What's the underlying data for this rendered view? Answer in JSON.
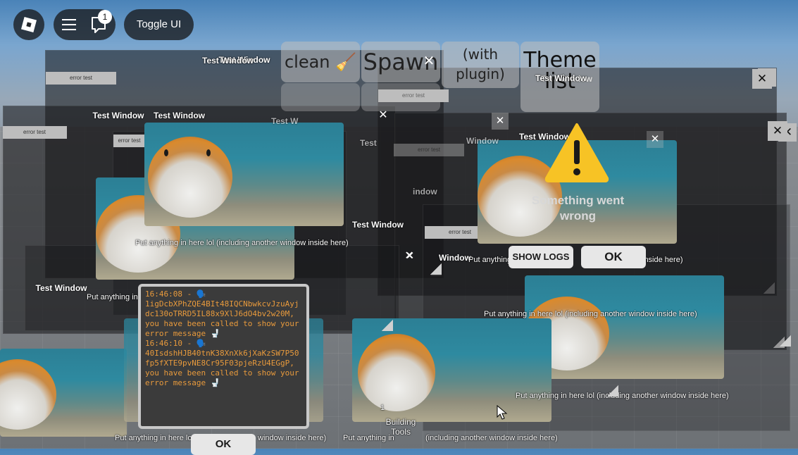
{
  "topbar": {
    "notification_count": "1",
    "toggle_label": "Toggle UI"
  },
  "toolbar": {
    "clean_label": "clean 🧹",
    "spawn_label": "Spawn",
    "plugin_label": "(with plugin)",
    "theme_label": "Theme list",
    "close_glyph": "✕"
  },
  "windows": {
    "title": "Test Window",
    "tab_label": "error test",
    "close_glyph": "✕",
    "caption": "Put anything in here lol (including another window inside here)",
    "caption_partial_1": "Put anything in here lo",
    "caption_partial_2": "window inside here)",
    "caption_partial_3": "Put anything in here lol",
    "caption_partial_4": "(including another window inside here)",
    "caption_partial_5": "Put anything in",
    "caption_partial_6": "inside here)",
    "title_partial_1": "Test Window",
    "title_partial_2": "Test",
    "title_partial_3": "indow",
    "title_partial_4": "Test Window",
    "title_partial_5": "Window",
    "title_partial_6": "Test W",
    "title_partial_7": "Test Window"
  },
  "error_dialog": {
    "message": "Something went wrong",
    "show_logs_label": "SHOW LOGS",
    "ok_label": "OK"
  },
  "log_panel": {
    "text": "16:46:08 - 🗣️\n1igDcbXPhZQE4BIt48IQCNbwkcvJzuAyjdc130oTRRD5IL88x9XlJ6dO4bv2w20M, you have been called to show your error message 🚽\n16:46:10 - 🗣️\n40IsdshHJB40tnK38XnXk6jXaKzSW7P50fp5fXTE9pvNE8Cr95F03pjeRzU4EGgP, you have been called to show your error message 🚽",
    "ok_label": "OK"
  },
  "building_tools": {
    "count": "1",
    "label": "Building Tools"
  }
}
